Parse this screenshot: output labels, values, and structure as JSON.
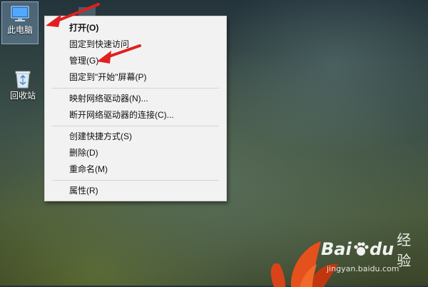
{
  "desktop": {
    "icons": [
      {
        "label": "此电脑",
        "icon": "computer-icon",
        "selected": true
      },
      {
        "label": "回收站",
        "icon": "recycle-bin-icon",
        "selected": false
      }
    ]
  },
  "context_menu": {
    "groups": [
      [
        {
          "label": "打开(O)",
          "bold": true
        },
        {
          "label": "固定到快速访问"
        },
        {
          "label": "管理(G)"
        },
        {
          "label": "固定到\"开始\"屏幕(P)"
        }
      ],
      [
        {
          "label": "映射网络驱动器(N)..."
        },
        {
          "label": "断开网络驱动器的连接(C)..."
        }
      ],
      [
        {
          "label": "创建快捷方式(S)"
        },
        {
          "label": "删除(D)"
        },
        {
          "label": "重命名(M)"
        }
      ],
      [
        {
          "label": "属性(R)"
        }
      ]
    ]
  },
  "annotations": {
    "color": "#e02020",
    "count": 2
  },
  "watermark": {
    "brand_left": "Bai",
    "brand_right": "du",
    "brand_cn": "经验",
    "url": "jingyan.baidu.com"
  }
}
